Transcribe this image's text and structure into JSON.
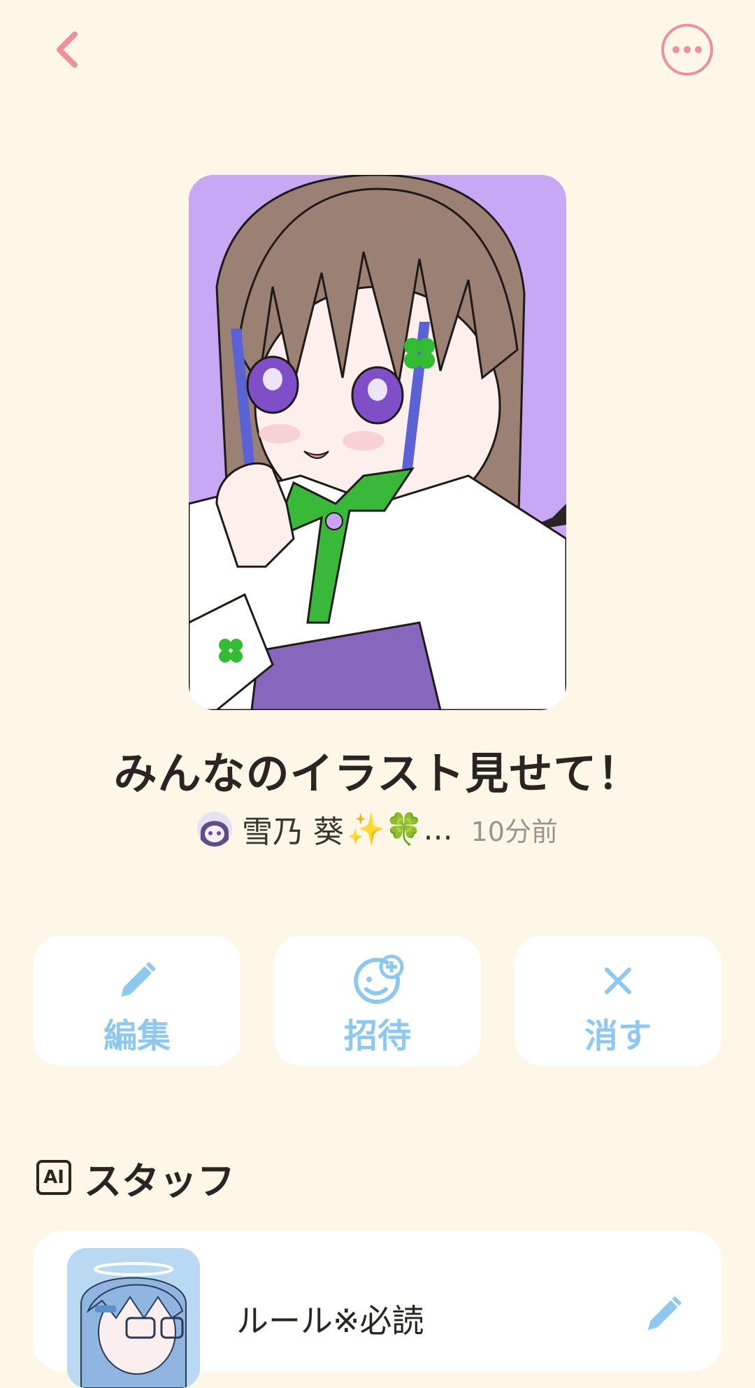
{
  "header": {
    "back_icon": "chevron-left-icon",
    "more_icon": "more-horizontal-icon",
    "accent_color": "#ee8fa0"
  },
  "room": {
    "title": "みんなのイラスト見せて！",
    "author_name": "雪乃 葵",
    "author_emoji": "✨🍀",
    "author_ellipsis": "...",
    "time_ago": "10分前"
  },
  "actions": {
    "edit_label": "編集",
    "invite_label": "招待",
    "delete_label": "消す",
    "action_color": "#8ec8ef"
  },
  "staff": {
    "badge": "AI",
    "heading": "スタッフ",
    "items": [
      {
        "title": "ルール※必読",
        "icon": "pencil-icon"
      }
    ]
  }
}
